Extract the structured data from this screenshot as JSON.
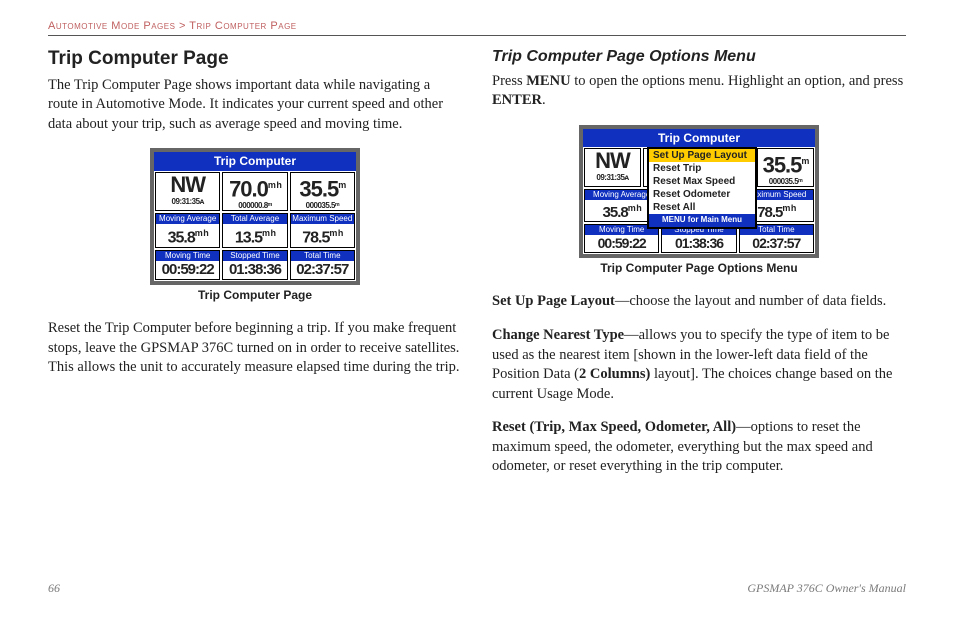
{
  "breadcrumb": {
    "section": "Automotive Mode Pages",
    "sep": " > ",
    "page": "Trip Computer Page"
  },
  "left": {
    "heading": "Trip Computer Page",
    "p1": "The Trip Computer Page shows important data while navigating a route in Automotive Mode. It indicates your current speed and other data about your trip, such as average speed and moving time.",
    "p2": "Reset the Trip Computer before beginning a trip. If you make frequent stops, leave the GPSMAP 376C turned on in order to receive satellites. This allows the unit to accurately measure elapsed time during the trip.",
    "caption": "Trip Computer Page"
  },
  "right": {
    "heading": "Trip Computer Page Options Menu",
    "intro_a": "Press ",
    "intro_b_menu": "MENU",
    "intro_c": " to open the options menu. Highlight an option, and press ",
    "intro_d_enter": "ENTER",
    "intro_e": ".",
    "caption": "Trip Computer Page Options Menu",
    "opt1_b": "Set Up Page Layout",
    "opt1_t": "—choose the layout and number of data fields.",
    "opt2_b": "Change Nearest Type",
    "opt2_t1": "—allows you to specify the type of item to be used as the nearest item [shown in the lower-left data field of the Position Data (",
    "opt2_t2": "2 Columns)",
    "opt2_t3": " layout]. The choices change based on the current Usage Mode.",
    "opt3_b": "Reset (Trip, Max Speed, Odometer, All)",
    "opt3_t": "—options to reset the maximum speed, the odometer, everything but the max speed and odometer, or reset everything in the trip computer."
  },
  "device": {
    "title": "Trip Computer",
    "r1": {
      "c1": {
        "big": "NW",
        "small": "09:31:35ᴀ"
      },
      "c2": {
        "big": "70.0",
        "unit": "m h",
        "small": "000000.8ᵐ"
      },
      "c3": {
        "big": "35.5",
        "unit": "m",
        "small": "000035.5ᵐ"
      }
    },
    "r2": {
      "l1": "Moving Average",
      "v1": "35.8",
      "u1": "m h",
      "l2": "Total Average",
      "v2": "13.5",
      "u2": "m h",
      "l3": "Maximum Speed",
      "v3": "78.5",
      "u3": "m h"
    },
    "r3": {
      "l1": "Moving Time",
      "v1": "00:59:22",
      "l2": "Stopped Time",
      "v2": "01:38:36",
      "l3": "Total Time",
      "v3": "02:37:57"
    }
  },
  "menu": {
    "items": [
      "Set Up Page Layout",
      "Reset Trip",
      "Reset Max Speed",
      "Reset Odometer",
      "Reset All"
    ],
    "footer": "MENU for Main Menu"
  },
  "footer": {
    "pagenum": "66",
    "manual": "GPSMAP 376C Owner's Manual"
  }
}
